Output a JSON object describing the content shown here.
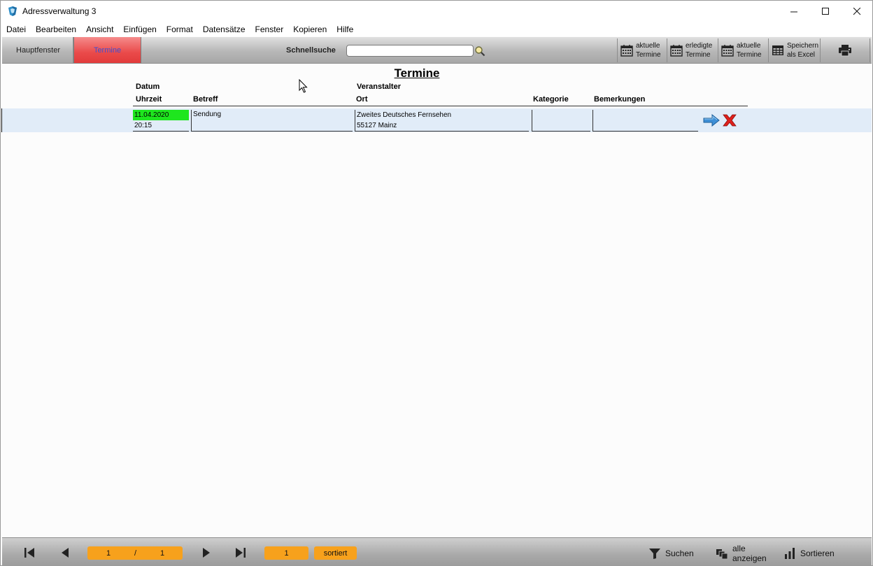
{
  "window": {
    "title": "Adressverwaltung 3"
  },
  "menu": [
    "Datei",
    "Bearbeiten",
    "Ansicht",
    "Einfügen",
    "Format",
    "Datensätze",
    "Fenster",
    "Kopieren",
    "Hilfe"
  ],
  "toolbar": {
    "tab_main": "Hauptfenster",
    "tab_termine": "Termine",
    "quick_search_label": "Schnellsuche",
    "quick_search_value": "",
    "btn_aktuell1_l1": "aktuelle",
    "btn_aktuell1_l2": "Termine",
    "btn_erledigt_l1": "erledigte",
    "btn_erledigt_l2": "Termine",
    "btn_aktuell2_l1": "aktuelle",
    "btn_aktuell2_l2": "Termine",
    "btn_excel_l1": "Speichern",
    "btn_excel_l2": "als Excel"
  },
  "main": {
    "title": "Termine",
    "headers": {
      "datum": "Datum",
      "uhrzeit": "Uhrzeit",
      "betreff": "Betreff",
      "veranstalter": "Veranstalter",
      "ort": "Ort",
      "kategorie": "Kategorie",
      "bemerkungen": "Bemerkungen"
    },
    "rows": [
      {
        "datum": "11.04.2020",
        "uhrzeit": "20:15",
        "betreff": "Sendung",
        "veranstalter": "Zweites Deutsches Fernsehen",
        "ort": "55127 Mainz",
        "kategorie": "",
        "bemerkungen": ""
      }
    ]
  },
  "bottom": {
    "record_current": "1",
    "record_sep": "/",
    "record_total": "1",
    "count": "1",
    "sort_state": "sortiert",
    "btn_suchen": "Suchen",
    "btn_alle_l1": "alle",
    "btn_alle_l2": "anzeigen",
    "btn_sortieren": "Sortieren"
  },
  "colors": {
    "active_tab": "#e23b3b",
    "date_highlight": "#1ee61e",
    "row_bg": "#e1ecf8",
    "pill": "#f7a11c"
  }
}
